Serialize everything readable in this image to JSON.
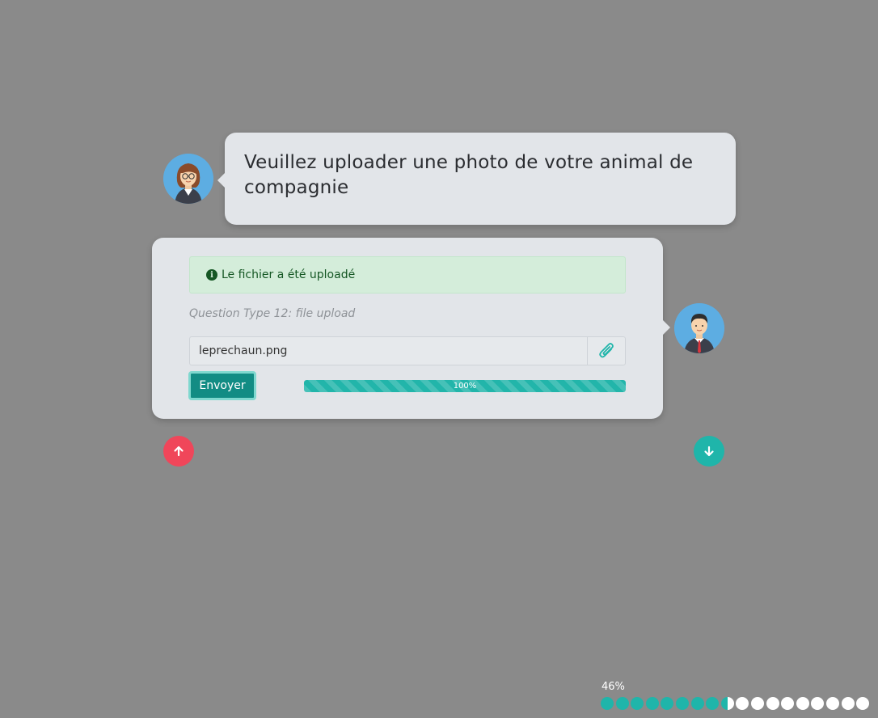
{
  "question": {
    "text": "Veuillez uploader une photo de votre animal de compagnie"
  },
  "upload": {
    "alert_text": "Le fichier a été uploadé",
    "hint": "Question Type 12: file upload",
    "file_name": "leprechaun.png",
    "send_label": "Envoyer",
    "progress_label": "100%",
    "progress_value": 100
  },
  "icons": {
    "alert": "info-circle-icon",
    "attach": "paperclip-icon",
    "nav_up": "arrow-up-icon",
    "nav_down": "arrow-down-icon"
  },
  "overall_progress": {
    "label": "46%",
    "value": 0.46,
    "total_steps": 18,
    "completed_steps": 8,
    "partial_step": true
  },
  "colors": {
    "background": "#8a8a8a",
    "bubble": "#e2e5e9",
    "accent": "#1fb5aa",
    "send_button": "#128c84",
    "up_button": "#f0465a",
    "alert_bg": "#d4edda",
    "alert_text": "#155724"
  }
}
